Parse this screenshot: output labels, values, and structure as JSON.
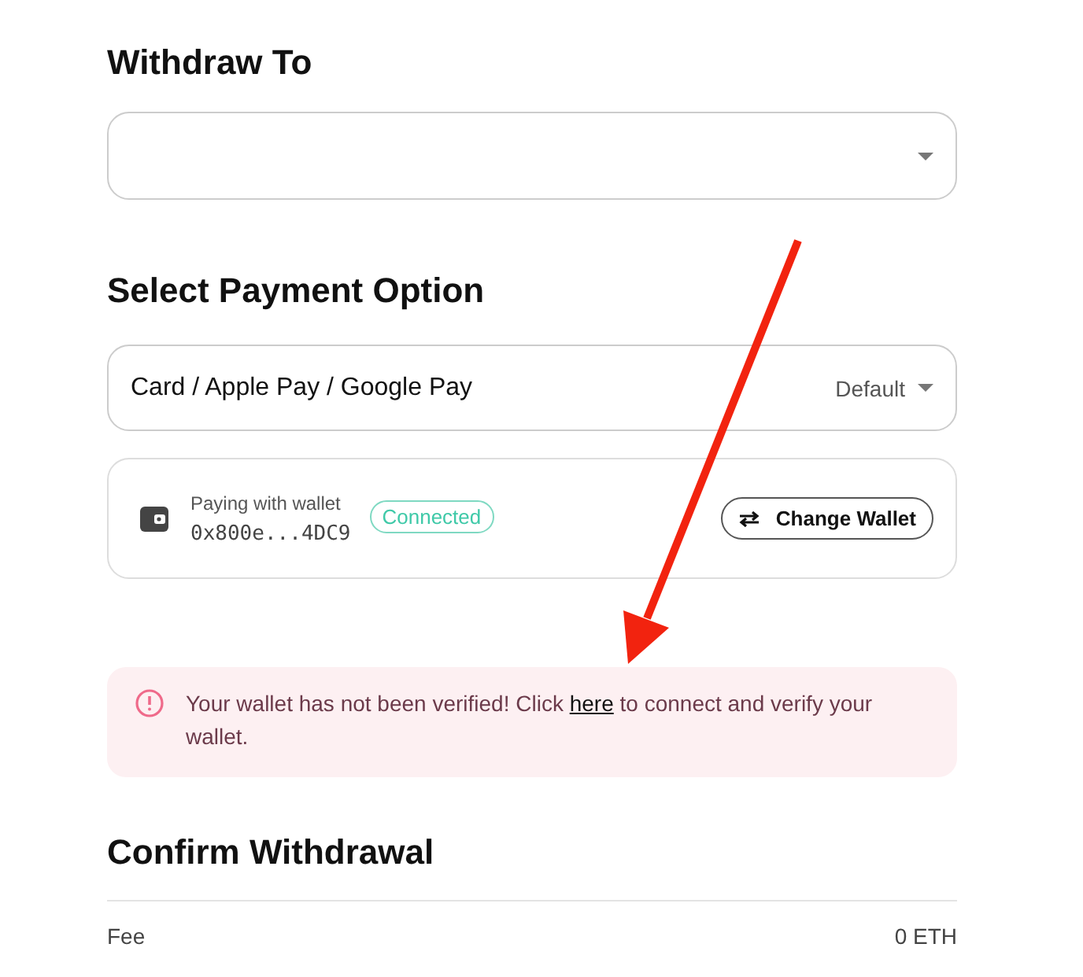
{
  "withdraw_to": {
    "heading": "Withdraw To"
  },
  "payment": {
    "heading": "Select Payment Option",
    "method": {
      "value": "Card / Apple Pay / Google Pay",
      "badge": "Default"
    },
    "wallet": {
      "label": "Paying with wallet",
      "address": "0x800e...4DC9",
      "status": "Connected",
      "connected": true,
      "button": "Change Wallet"
    }
  },
  "alert": {
    "text_before": "Your wallet has not been verified! Click ",
    "link": "here",
    "text_after": " to connect and verify your wallet."
  },
  "confirm": {
    "heading": "Confirm Withdrawal",
    "rows": [
      {
        "label": "Fee",
        "value": "0 ETH"
      }
    ]
  },
  "annotation": {
    "kind": "arrow"
  }
}
